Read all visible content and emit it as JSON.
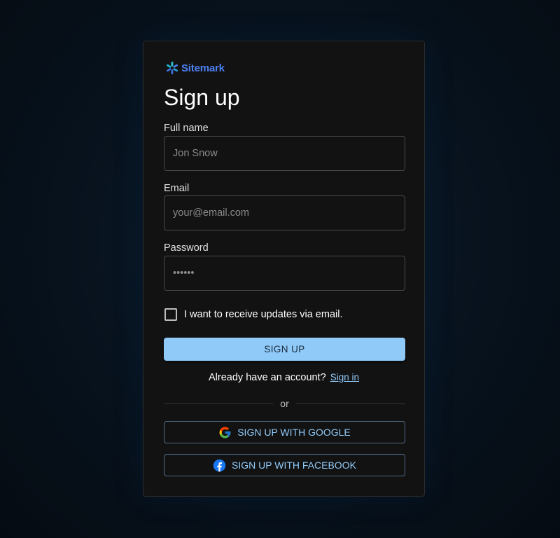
{
  "brand": {
    "name": "Sitemark",
    "color": "#4d7ff0"
  },
  "form": {
    "title": "Sign up",
    "fields": [
      {
        "label": "Full name",
        "placeholder": "Jon Snow"
      },
      {
        "label": "Email",
        "placeholder": "your@email.com"
      },
      {
        "label": "Password",
        "placeholder": "••••••"
      }
    ],
    "updates_checkbox": {
      "label": "I want to receive updates via email.",
      "checked": false
    },
    "submit_label": "SIGN UP",
    "signin_prompt": "Already have an account?",
    "signin_link": "Sign in",
    "divider_text": "or",
    "social": {
      "google_label": "SIGN UP WITH GOOGLE",
      "google_icon": "google-icon",
      "facebook_label": "SIGN UP WITH FACEBOOK",
      "facebook_icon": "facebook-icon"
    }
  },
  "colors": {
    "accent": "#90caf9",
    "card_bg": "#121212",
    "page_bg": "#07121d"
  }
}
